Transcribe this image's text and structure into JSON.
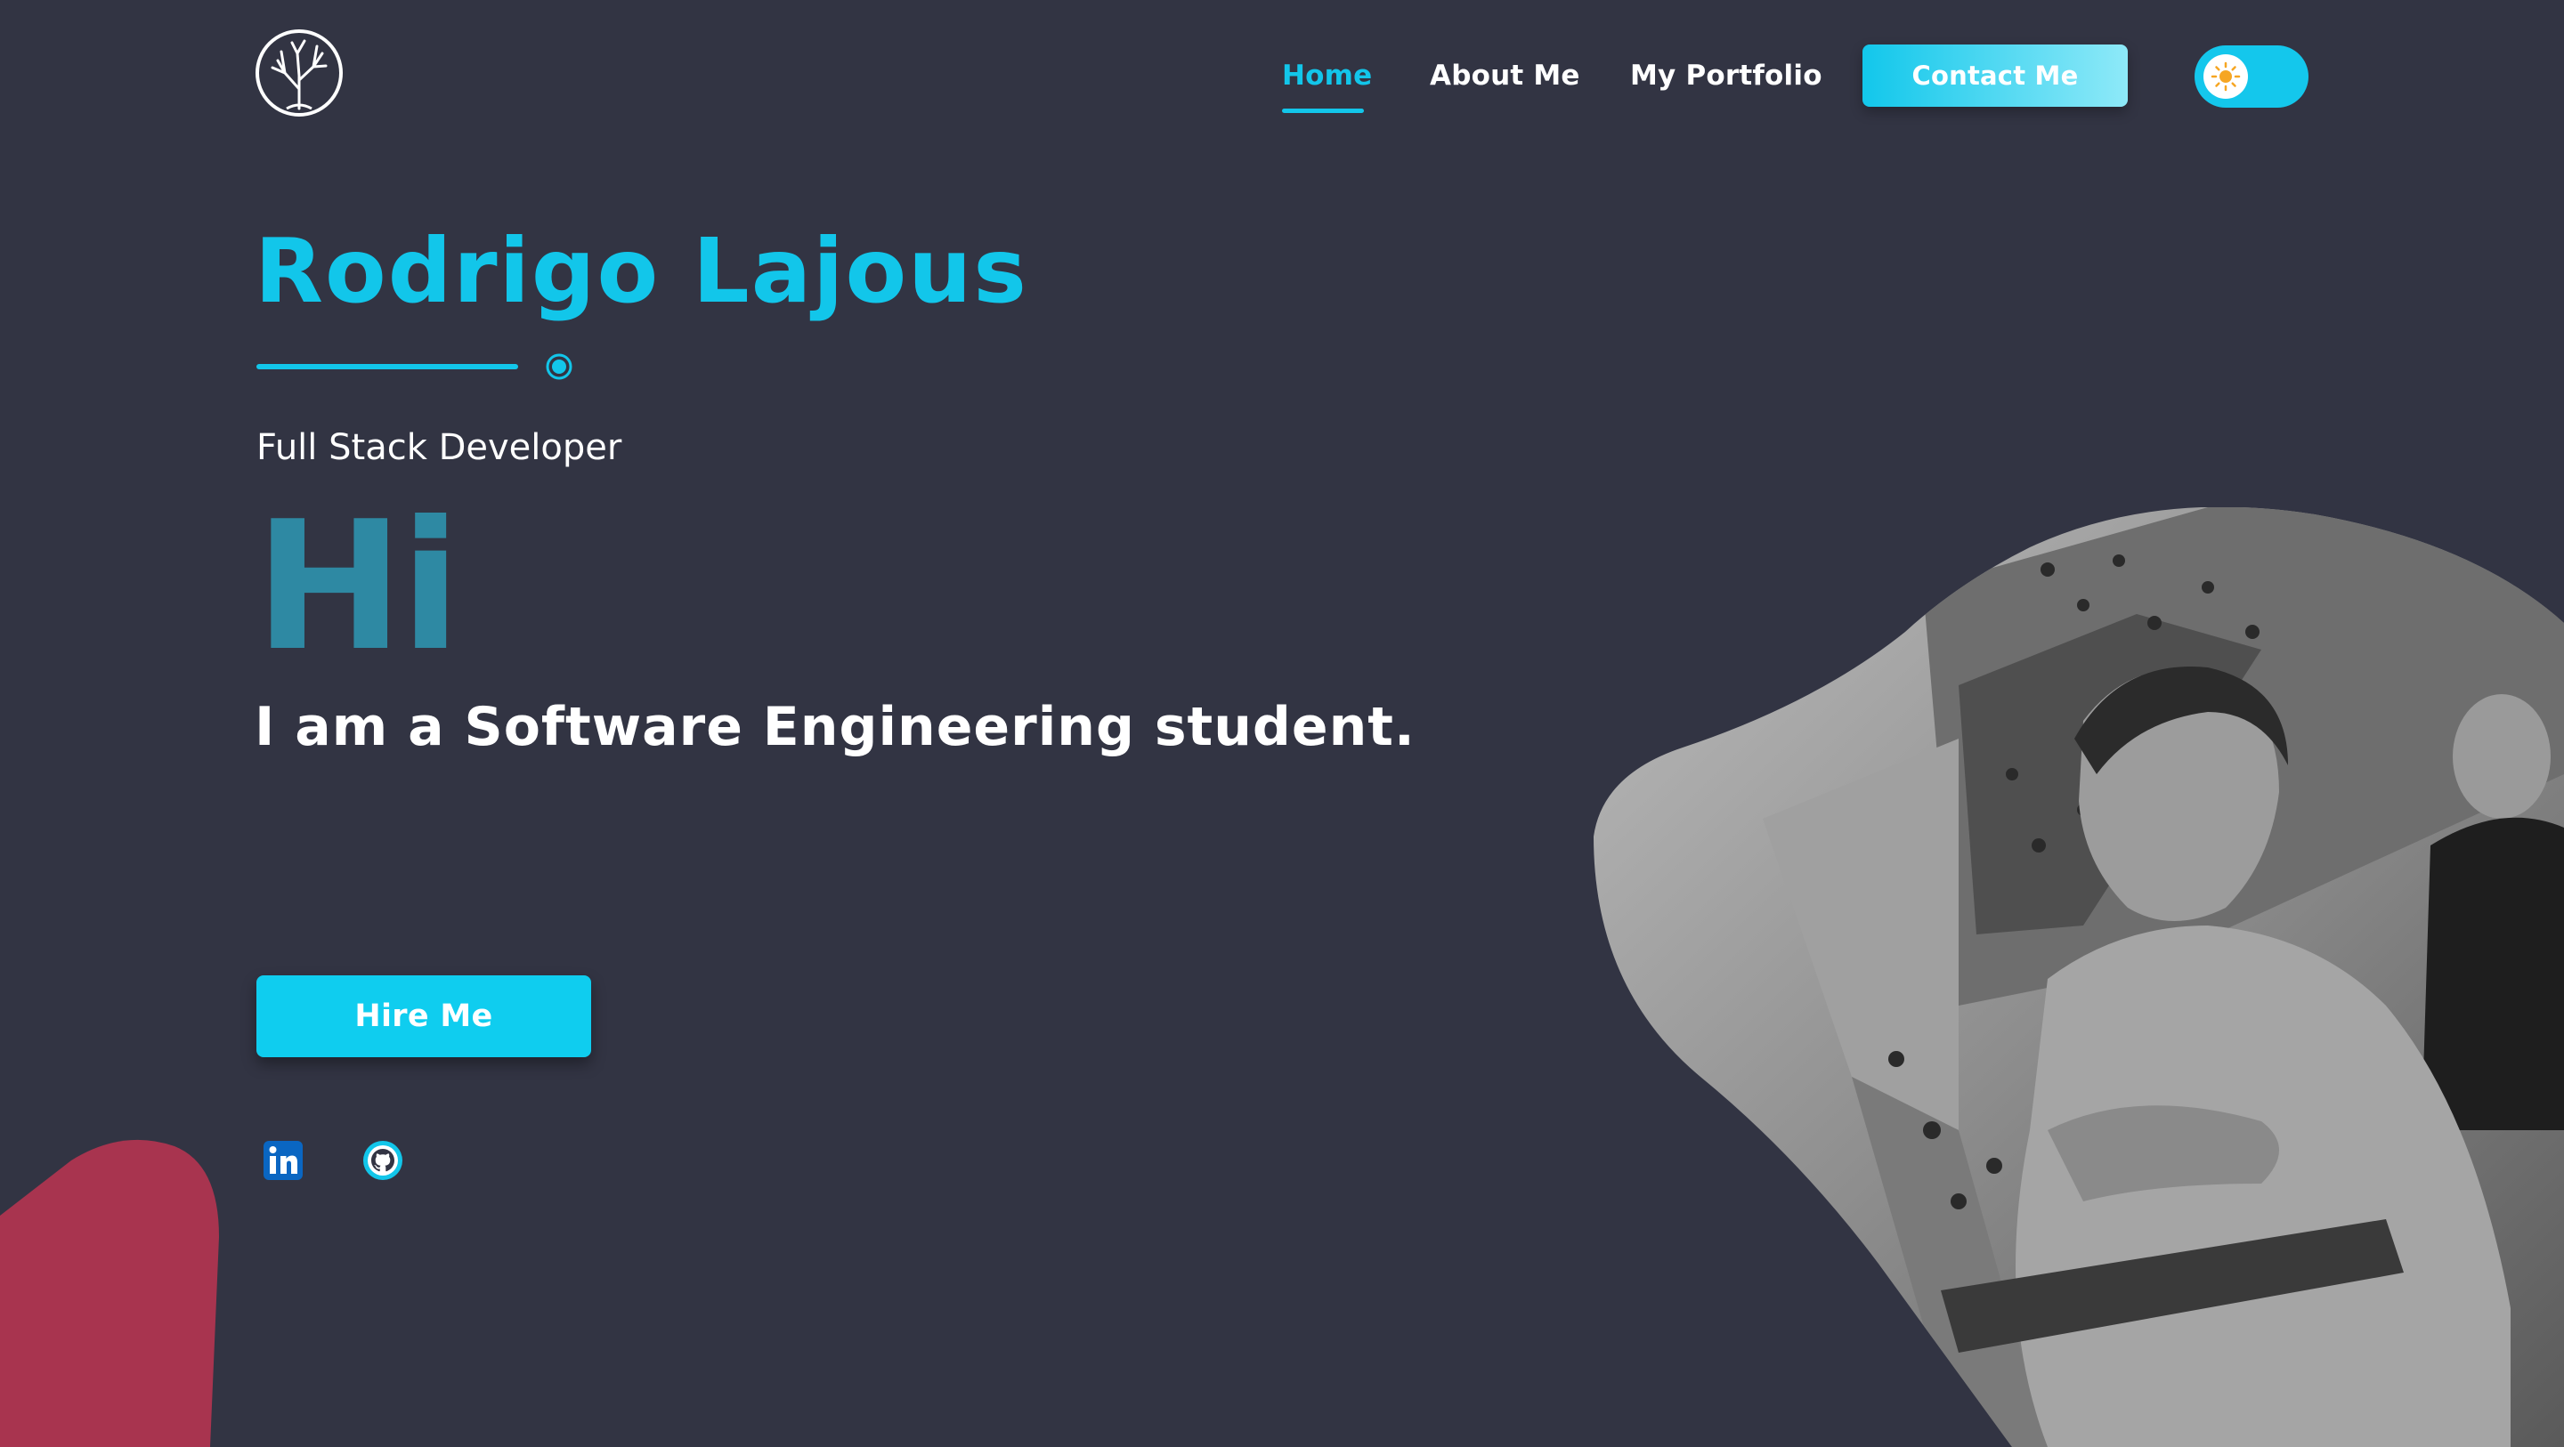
{
  "header": {
    "logo_icon": "tree-icon",
    "nav": [
      {
        "label": "Home",
        "active": true
      },
      {
        "label": "About Me",
        "active": false
      },
      {
        "label": "My Portfolio",
        "active": false
      }
    ],
    "contact_label": "Contact Me",
    "theme_toggle_icon": "sun-icon"
  },
  "hero": {
    "name": "Rodrigo Lajous",
    "role": "Full Stack Developer",
    "greeting": "Hi",
    "tagline": "I am a Software Engineering student.",
    "cta_label": "Hire Me",
    "social_icons": [
      "linkedin-icon",
      "github-icon"
    ]
  },
  "colors": {
    "background": "#323443",
    "accent": "#12c6ea",
    "greeting": "#2e89a3",
    "blob": "#a8344f"
  }
}
